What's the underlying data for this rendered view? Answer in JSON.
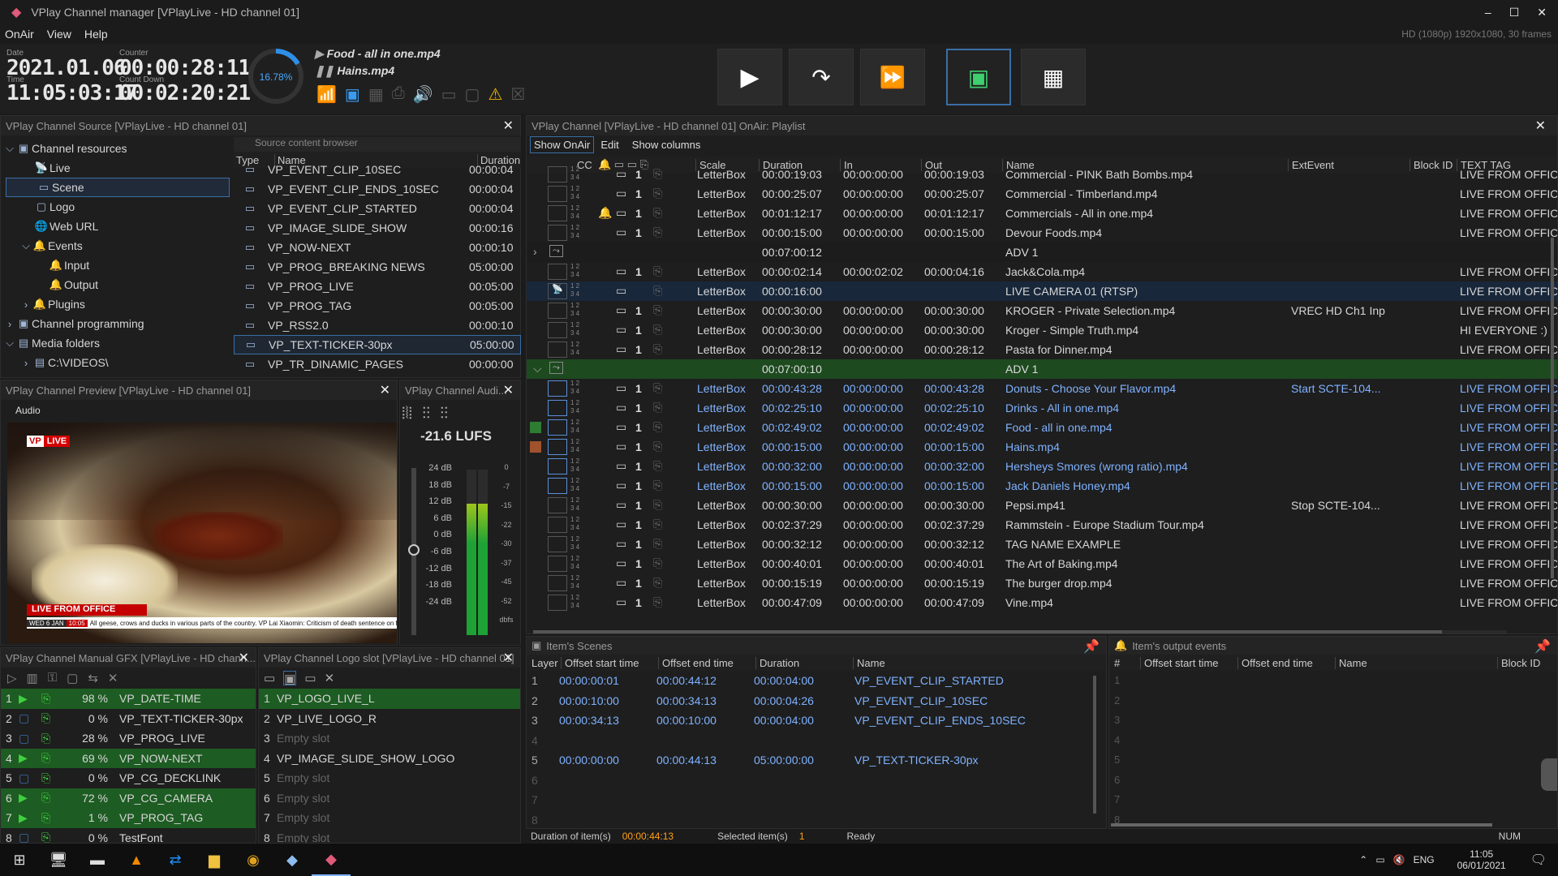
{
  "app": {
    "title": "VPlay Channel manager [VPlayLive - HD channel 01]",
    "format": "HD (1080p) 1920x1080, 30 frames"
  },
  "menu": [
    "OnAir",
    "View",
    "Help"
  ],
  "status": {
    "date_label": "Date",
    "date": "2021.01.06",
    "time_label": "Time",
    "time": "11:05:03:17",
    "counter_label": "Counter",
    "counter": "00:00:28:11",
    "countdown_label": "Count Down",
    "countdown": "00:02:20:21",
    "progress": "16.78%",
    "progress_value": 0.1678,
    "now_playing": "Food - all in one.mp4",
    "next": "Hains.mp4"
  },
  "source": {
    "title": "VPlay Channel Source [VPlayLive - HD channel 01]",
    "browser_title": "Source content browser",
    "tree": [
      "Channel resources",
      "Live",
      "Scene",
      "Logo",
      "Web URL",
      "Events",
      "Input",
      "Output",
      "Plugins",
      "Channel programming",
      "Media folders",
      "C:\\VIDEOS\\"
    ],
    "cols": [
      "Type",
      "Name",
      "Duration"
    ],
    "items": [
      [
        "VP_EVENT_CLIP_10SEC",
        "00:00:04"
      ],
      [
        "VP_EVENT_CLIP_ENDS_10SEC",
        "00:00:04"
      ],
      [
        "VP_EVENT_CLIP_STARTED",
        "00:00:04"
      ],
      [
        "VP_IMAGE_SLIDE_SHOW",
        "00:00:16"
      ],
      [
        "VP_NOW-NEXT",
        "00:00:10"
      ],
      [
        "VP_PROG_BREAKING NEWS",
        "05:00:00"
      ],
      [
        "VP_PROG_LIVE",
        "00:05:00"
      ],
      [
        "VP_PROG_TAG",
        "00:05:00"
      ],
      [
        "VP_RSS2.0",
        "00:00:10"
      ],
      [
        "VP_TEXT-TICKER-30px",
        "05:00:00"
      ],
      [
        "VP_TR_DINAMIC_PAGES",
        "00:00:00"
      ]
    ]
  },
  "preview": {
    "title": "VPlay Channel Preview [VPlayLive - HD channel 01]",
    "audio": "Audio",
    "badge_vp": "VP",
    "badge_live": "LIVE",
    "lower_third": "LIVE FROM OFFICE",
    "ticker_date": "WED 6 JAN",
    "ticker_time": "10:05",
    "ticker": "All geese, crows and ducks in various parts of the country.  VP  Lai Xiaomin: Criticism of death sentence on former Chinese t"
  },
  "audio": {
    "title": "VPlay Channel Audi...",
    "lufs": "-21.6 LUFS",
    "left_scale": [
      "24 dB",
      "18 dB",
      "12 dB",
      "6 dB",
      "0 dB",
      "-6 dB",
      "-12 dB",
      "-18 dB",
      "-24 dB"
    ],
    "right_scale": [
      "0",
      "-7",
      "-15",
      "-22",
      "-30",
      "-37",
      "-45",
      "-52",
      "dbfs"
    ]
  },
  "gfx": {
    "title": "VPlay Channel Manual GFX [VPlayLive - HD chann...",
    "rows": [
      [
        "1",
        "98 %",
        "VP_DATE-TIME",
        true
      ],
      [
        "2",
        "0 %",
        "VP_TEXT-TICKER-30px",
        false
      ],
      [
        "3",
        "28 %",
        "VP_PROG_LIVE",
        false
      ],
      [
        "4",
        "69 %",
        "VP_NOW-NEXT",
        true
      ],
      [
        "5",
        "0 %",
        "VP_CG_DECKLINK",
        false
      ],
      [
        "6",
        "72 %",
        "VP_CG_CAMERA",
        true
      ],
      [
        "7",
        "1 %",
        "VP_PROG_TAG",
        true
      ],
      [
        "8",
        "0 %",
        "TestFont",
        false
      ]
    ]
  },
  "logo": {
    "title": "VPlay Channel Logo slot [VPlayLive - HD channel 01]",
    "rows": [
      [
        "1",
        "VP_LOGO_LIVE_L",
        true
      ],
      [
        "2",
        "VP_LIVE_LOGO_R",
        false
      ],
      [
        "3",
        "Empty slot",
        false
      ],
      [
        "4",
        "VP_IMAGE_SLIDE_SHOW_LOGO",
        false
      ],
      [
        "5",
        "Empty slot",
        false
      ],
      [
        "6",
        "Empty slot",
        false
      ],
      [
        "7",
        "Empty slot",
        false
      ],
      [
        "8",
        "Empty slot",
        false
      ]
    ]
  },
  "playlist": {
    "title": "VPlay Channel [VPlayLive - HD channel 01] OnAir: Playlist",
    "tabs": [
      "Show OnAir",
      "Edit",
      "Show columns"
    ],
    "cols": [
      "CC",
      "Scale",
      "Duration",
      "In",
      "Out",
      "Name",
      "ExtEvent",
      "Block ID",
      "TEXT TAG"
    ],
    "rows": [
      {
        "t": "i",
        "s": "LetterBox",
        "d": "00:00:19:03",
        "i": "00:00:00:00",
        "o": "00:00:19:03",
        "n": "Commercial - PINK Bath Bombs.mp4",
        "e": "",
        "tag": "LIVE FROM OFFICE"
      },
      {
        "t": "i",
        "s": "LetterBox",
        "d": "00:00:25:07",
        "i": "00:00:00:00",
        "o": "00:00:25:07",
        "n": "Commercial - Timberland.mp4",
        "e": "",
        "tag": "LIVE FROM OFFICE"
      },
      {
        "t": "i",
        "s": "LetterBox",
        "d": "00:01:12:17",
        "i": "00:00:00:00",
        "o": "00:01:12:17",
        "n": "Commercials - All in one.mp4",
        "e": "",
        "tag": "LIVE FROM OFFICE"
      },
      {
        "t": "i",
        "s": "LetterBox",
        "d": "00:00:15:00",
        "i": "00:00:00:00",
        "o": "00:00:15:00",
        "n": "Devour Foods.mp4",
        "e": "",
        "tag": "LIVE FROM OFFICE"
      },
      {
        "t": "b",
        "d": "00:07:00:12",
        "n": "ADV 1"
      },
      {
        "t": "i",
        "s": "LetterBox",
        "d": "00:00:02:14",
        "i": "00:00:02:02",
        "o": "00:00:04:16",
        "n": "Jack&Cola.mp4",
        "e": "",
        "tag": "LIVE FROM OFFICE"
      },
      {
        "t": "l",
        "s": "LetterBox",
        "d": "00:00:16:00",
        "i": "",
        "o": "",
        "n": "LIVE CAMERA 01 (RTSP)",
        "e": "",
        "tag": "LIVE FROM OFFICE"
      },
      {
        "t": "i",
        "s": "LetterBox",
        "d": "00:00:30:00",
        "i": "00:00:00:00",
        "o": "00:00:30:00",
        "n": "KROGER - Private Selection.mp4",
        "e": "VREC HD Ch1 Inp",
        "tag": "LIVE FROM OFFICE"
      },
      {
        "t": "i",
        "s": "LetterBox",
        "d": "00:00:30:00",
        "i": "00:00:00:00",
        "o": "00:00:30:00",
        "n": "Kroger - Simple Truth.mp4",
        "e": "",
        "tag": "HI EVERYONE :)"
      },
      {
        "t": "i",
        "s": "LetterBox",
        "d": "00:00:28:12",
        "i": "00:00:00:00",
        "o": "00:00:28:12",
        "n": "Pasta for Dinner.mp4",
        "e": "",
        "tag": "LIVE FROM OFFICE"
      },
      {
        "t": "g",
        "d": "00:07:00:10",
        "n": "ADV 1"
      },
      {
        "t": "a",
        "s": "LetterBox",
        "d": "00:00:43:28",
        "i": "00:00:00:00",
        "o": "00:00:43:28",
        "n": "Donuts - Choose Your Flavor.mp4",
        "e": "Start SCTE-104...",
        "tag": "LIVE FROM OFFICE"
      },
      {
        "t": "a",
        "s": "LetterBox",
        "d": "00:02:25:10",
        "i": "00:00:00:00",
        "o": "00:02:25:10",
        "n": "Drinks - All in one.mp4",
        "e": "",
        "tag": "LIVE FROM OFFICE"
      },
      {
        "t": "a",
        "s": "LetterBox",
        "d": "00:02:49:02",
        "i": "00:00:00:00",
        "o": "00:02:49:02",
        "n": "Food - all in one.mp4",
        "e": "",
        "tag": "LIVE FROM OFFICE",
        "mark": "#2e7d32"
      },
      {
        "t": "a",
        "s": "LetterBox",
        "d": "00:00:15:00",
        "i": "00:00:00:00",
        "o": "00:00:15:00",
        "n": "Hains.mp4",
        "e": "",
        "tag": "LIVE FROM OFFICE",
        "mark": "#a0522d"
      },
      {
        "t": "a",
        "s": "LetterBox",
        "d": "00:00:32:00",
        "i": "00:00:00:00",
        "o": "00:00:32:00",
        "n": "Hersheys Smores (wrong ratio).mp4",
        "e": "",
        "tag": "LIVE FROM OFFICE"
      },
      {
        "t": "a",
        "s": "LetterBox",
        "d": "00:00:15:00",
        "i": "00:00:00:00",
        "o": "00:00:15:00",
        "n": "Jack Daniels Honey.mp4",
        "e": "",
        "tag": "LIVE FROM OFFICE"
      },
      {
        "t": "i",
        "s": "LetterBox",
        "d": "00:00:30:00",
        "i": "00:00:00:00",
        "o": "00:00:30:00",
        "n": "Pepsi.mp41",
        "e": "Stop SCTE-104...",
        "tag": "LIVE FROM OFFICE"
      },
      {
        "t": "i",
        "s": "LetterBox",
        "d": "00:02:37:29",
        "i": "00:00:00:00",
        "o": "00:02:37:29",
        "n": "Rammstein - Europe Stadium Tour.mp4",
        "e": "",
        "tag": "LIVE FROM OFFICE"
      },
      {
        "t": "i",
        "s": "LetterBox",
        "d": "00:00:32:12",
        "i": "00:00:00:00",
        "o": "00:00:32:12",
        "n": "TAG NAME EXAMPLE",
        "e": "",
        "tag": "LIVE FROM OFFICE"
      },
      {
        "t": "i",
        "s": "LetterBox",
        "d": "00:00:40:01",
        "i": "00:00:00:00",
        "o": "00:00:40:01",
        "n": "The Art of Baking.mp4",
        "e": "",
        "tag": "LIVE FROM OFFICE"
      },
      {
        "t": "i",
        "s": "LetterBox",
        "d": "00:00:15:19",
        "i": "00:00:00:00",
        "o": "00:00:15:19",
        "n": "The burger drop.mp4",
        "e": "",
        "tag": "LIVE FROM OFFICE"
      },
      {
        "t": "i",
        "s": "LetterBox",
        "d": "00:00:47:09",
        "i": "00:00:00:00",
        "o": "00:00:47:09",
        "n": "Vine.mp4",
        "e": "",
        "tag": "LIVE FROM OFFICE"
      }
    ]
  },
  "scenes": {
    "title": "Item's Scenes",
    "cols": [
      "Layer",
      "Offset start time",
      "Offset end time",
      "Duration",
      "Name"
    ],
    "rows": [
      [
        "1",
        "00:00:00:01",
        "00:00:44:12",
        "00:00:04:00",
        "VP_EVENT_CLIP_STARTED"
      ],
      [
        "2",
        "00:00:10:00",
        "00:00:34:13",
        "00:00:04:26",
        "VP_EVENT_CLIP_10SEC"
      ],
      [
        "3",
        "00:00:34:13",
        "00:00:10:00",
        "00:00:04:00",
        "VP_EVENT_CLIP_ENDS_10SEC"
      ],
      [
        "4",
        "",
        "",
        "",
        ""
      ],
      [
        "5",
        "00:00:00:00",
        "00:00:44:13",
        "05:00:00:00",
        "VP_TEXT-TICKER-30px"
      ],
      [
        "6",
        "",
        "",
        "",
        ""
      ],
      [
        "7",
        "",
        "",
        "",
        ""
      ],
      [
        "8",
        "",
        "",
        "",
        ""
      ]
    ]
  },
  "events": {
    "title": "Item's output events",
    "cols": [
      "#",
      "Offset start time",
      "Offset end time",
      "Name",
      "Block ID"
    ],
    "rows": [
      "1",
      "2",
      "3",
      "4",
      "5",
      "6",
      "7",
      "8"
    ]
  },
  "statusbar": {
    "dur_label": "Duration of item(s)",
    "dur": "00:00:44:13",
    "sel_label": "Selected item(s)",
    "sel": "1",
    "ready": "Ready",
    "num": "NUM"
  },
  "taskbar": {
    "lang": "ENG",
    "time": "11:05",
    "date": "06/01/2021"
  }
}
